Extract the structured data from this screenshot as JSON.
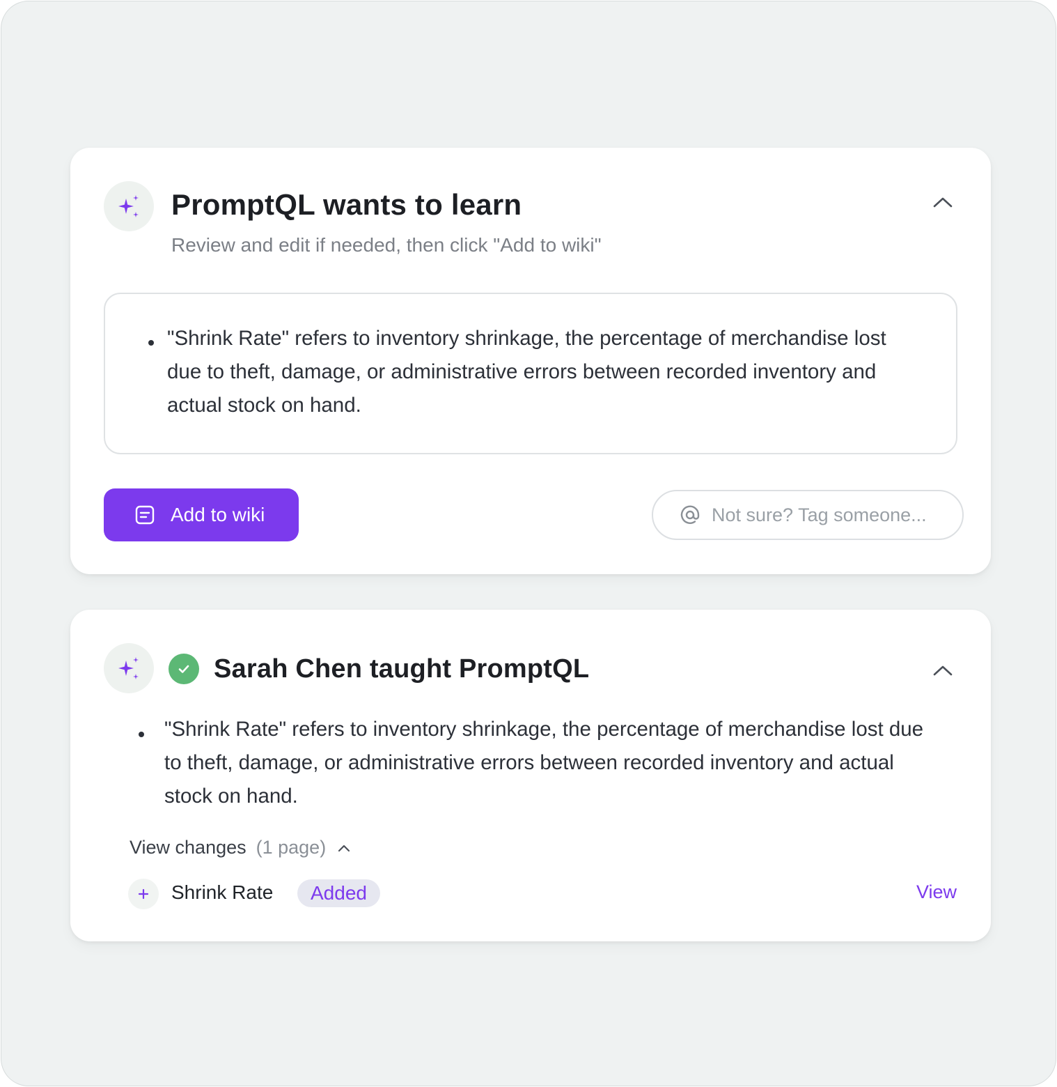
{
  "colors": {
    "accent": "#7c3aed",
    "success": "#5cb875",
    "background": "#eff2f2",
    "card": "#ffffff"
  },
  "learn_card": {
    "icon": "sparkles-icon",
    "title": "PromptQL wants to learn",
    "subtitle": "Review and edit if needed, then click \"Add to wiki\"",
    "collapse_icon": "chevron-up-icon",
    "editor_bullets": [
      "\"Shrink Rate\" refers to inventory shrinkage, the percentage of merchandise lost due to theft, damage, or administrative errors between recorded inventory and actual stock on hand."
    ],
    "add_button_icon": "document-icon",
    "add_button_label": "Add to wiki",
    "tag_icon": "at-sign-icon",
    "tag_placeholder": "Not sure? Tag someone..."
  },
  "taught_card": {
    "icon": "sparkles-icon",
    "status_icon": "check-circle-icon",
    "title": "Sarah Chen taught PromptQL",
    "collapse_icon": "chevron-up-icon",
    "bullets": [
      "\"Shrink Rate\" refers to inventory shrinkage, the percentage of merchandise lost due to theft, damage, or administrative errors between recorded inventory and actual stock on hand."
    ],
    "changes_label": "View changes",
    "changes_count": "(1 page)",
    "pages": [
      {
        "icon": "plus-icon",
        "name": "Shrink Rate",
        "status": "Added",
        "link": "View"
      }
    ]
  }
}
